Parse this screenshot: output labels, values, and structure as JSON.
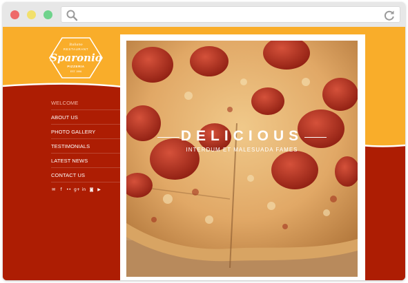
{
  "browser": {
    "traffic_lights": [
      "close",
      "minimize",
      "maximize"
    ],
    "url": "",
    "icons": {
      "search": "search-icon",
      "reload": "reload-icon"
    }
  },
  "site": {
    "logo": {
      "top_small": "Italiano",
      "restaurant": "RESTAURANT",
      "name": "Sparonio",
      "pizzeria": "PIZZERIA",
      "est": "EST. 1996"
    },
    "nav": [
      {
        "label": "Welcome",
        "active": true
      },
      {
        "label": "About Us",
        "active": false
      },
      {
        "label": "Photo Gallery",
        "active": false
      },
      {
        "label": "Testimonials",
        "active": false
      },
      {
        "label": "Latest News",
        "active": false
      },
      {
        "label": "Contact Us",
        "active": false
      }
    ],
    "social_icons": [
      "mail-icon",
      "facebook-icon",
      "flickr-icon",
      "google-plus-icon",
      "linkedin-icon",
      "instagram-icon",
      "youtube-icon"
    ],
    "social_glyphs": [
      "✉",
      "f",
      "••",
      "g+",
      "in",
      "◙",
      "▶"
    ],
    "hero": {
      "title": "DELICIOUS",
      "subtitle": "Interdum et malesuada fames"
    },
    "colors": {
      "orange": "#f9ad2a",
      "red": "#ad1d03",
      "white": "#ffffff"
    }
  }
}
